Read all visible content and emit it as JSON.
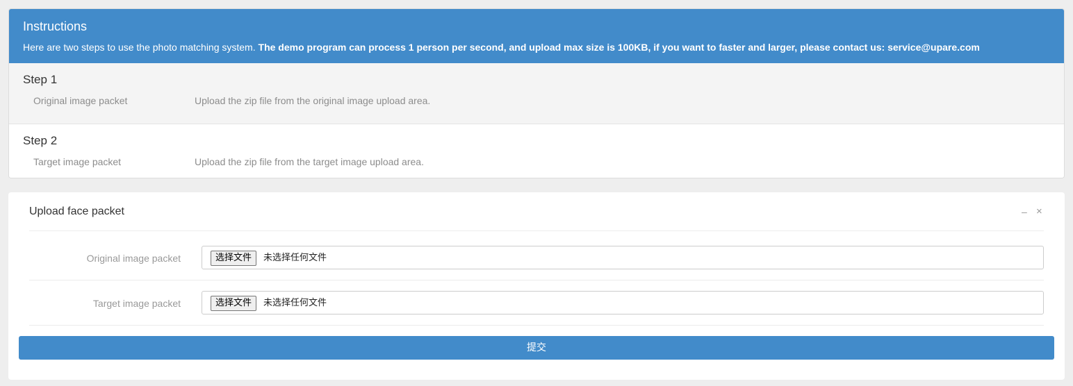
{
  "instructions": {
    "title": "Instructions",
    "description_intro": "Here are two steps to use the photo matching system. ",
    "description_bold": "The demo program can process 1 person per second, and upload max size is 100KB, if you want to faster and larger, please contact us: service@upare.com",
    "steps": [
      {
        "title": "Step 1",
        "label": "Original image packet",
        "text": "Upload the zip file from the original image upload area."
      },
      {
        "title": "Step 2",
        "label": "Target image packet",
        "text": "Upload the zip file from the target image upload area."
      }
    ]
  },
  "upload": {
    "title": "Upload face packet",
    "minimize_symbol": "–",
    "close_symbol": "×",
    "fields": [
      {
        "label": "Original image packet",
        "button_label": "选择文件",
        "status": "未选择任何文件"
      },
      {
        "label": "Target image packet",
        "button_label": "选择文件",
        "status": "未选择任何文件"
      }
    ],
    "submit_label": "提交"
  },
  "colors": {
    "accent": "#428bca",
    "background": "#eeeeee"
  }
}
